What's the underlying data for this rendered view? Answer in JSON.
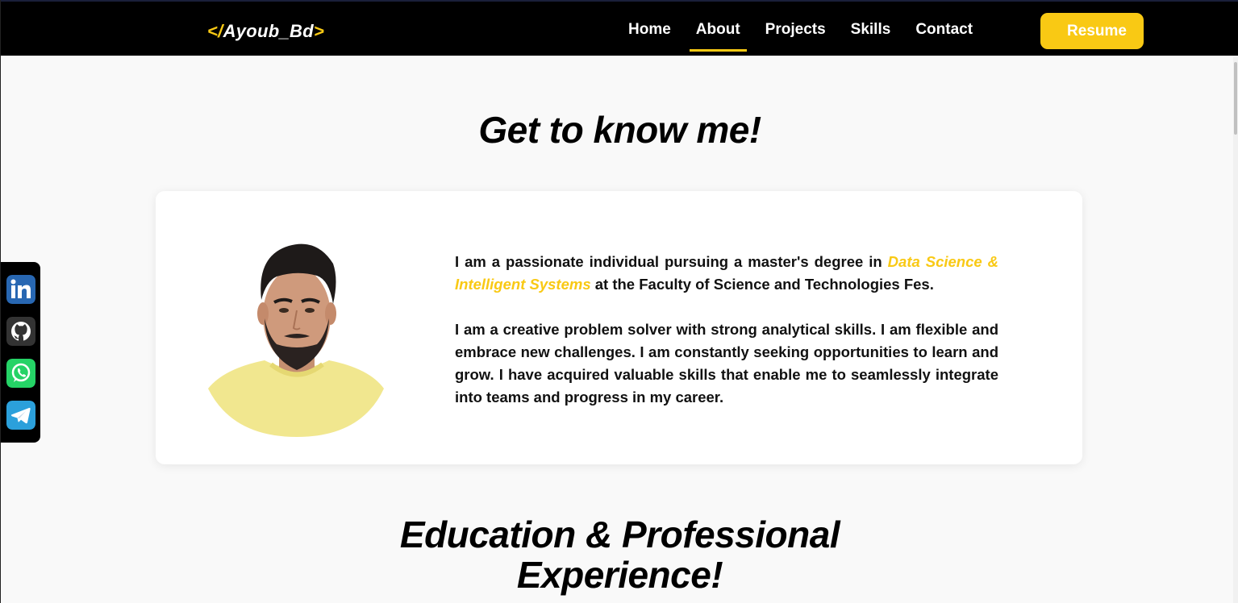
{
  "navbar": {
    "logo_open": "</",
    "logo_name": "Ayoub_Bd",
    "logo_close": ">",
    "links": [
      {
        "label": "Home",
        "active": false
      },
      {
        "label": "About",
        "active": true
      },
      {
        "label": "Projects",
        "active": false
      },
      {
        "label": "Skills",
        "active": false
      },
      {
        "label": "Contact",
        "active": false
      }
    ],
    "resume_label": "Resume"
  },
  "about": {
    "title": "Get to know me!",
    "paragraph1_part1": "I am a passionate individual pursuing a master's degree in ",
    "paragraph1_highlight": "Data Science & Intelligent Systems",
    "paragraph1_part2": " at the Faculty of Science and Technologies Fes.",
    "paragraph2": "I am a creative problem solver with strong analytical skills. I am flexible and embrace new challenges. I am constantly seeking opportunities to learn and grow. I have acquired valuable skills that enable me to seamlessly integrate into teams and progress in my career."
  },
  "education": {
    "title_line1": "Education & Professional",
    "title_line2": "Experience!"
  },
  "social": [
    {
      "icon": "linkedin-icon",
      "color": "#0a66c2"
    },
    {
      "icon": "github-icon",
      "color": "#2b2b2b"
    },
    {
      "icon": "whatsapp-icon",
      "color": "#25d366"
    },
    {
      "icon": "telegram-icon",
      "color": "#2aa3e0"
    }
  ],
  "colors": {
    "accent": "#f9c914",
    "navbar_bg": "#000000",
    "page_bg": "#f9f9f9"
  }
}
